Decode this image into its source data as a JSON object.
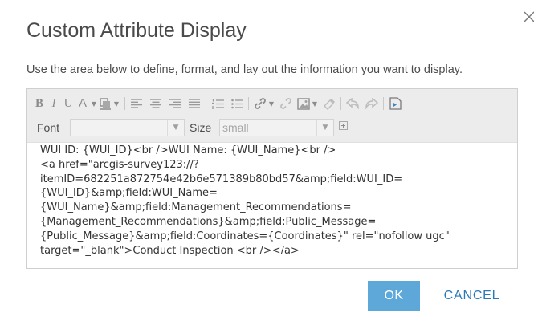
{
  "dialog": {
    "title": "Custom Attribute Display",
    "description": "Use the area below to define, format, and lay out the information you want to display."
  },
  "toolbar": {
    "bold": "B",
    "italic": "I",
    "underline": "U",
    "font_color": "A",
    "font_label": "Font",
    "font_value": "",
    "size_label": "Size",
    "size_value": "small"
  },
  "editor": {
    "lines": [
      "WUI ID: {WUI_ID}<br />WUI Name: {WUI_Name}<br />",
      "<a href=\"arcgis-survey123://?",
      "itemID=682251a872754e42b6e571389b80bd57&amp;field:WUI_ID=",
      "{WUI_ID}&amp;field:WUI_Name=",
      "{WUI_Name}&amp;field:Management_Recommendations=",
      "{Management_Recommendations}&amp;field:Public_Message=",
      "{Public_Message}&amp;field:Coordinates={Coordinates}\" rel=\"nofollow ugc\"",
      "target=\"_blank\">Conduct Inspection <br /></a>"
    ]
  },
  "buttons": {
    "ok": "OK",
    "cancel": "CANCEL"
  },
  "colors": {
    "ok_bg": "#5ea8d9",
    "cancel_text": "#2a7ab8",
    "toolbar_bg": "#ececec"
  }
}
